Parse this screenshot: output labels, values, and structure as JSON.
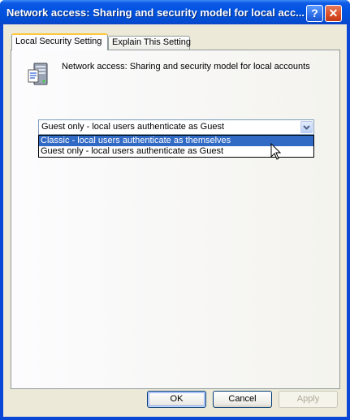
{
  "window": {
    "title": "Network access: Sharing and security model for local acc..."
  },
  "titlebar_buttons": {
    "help": "?",
    "close": "✕"
  },
  "tabs": [
    {
      "label": "Local Security Setting",
      "active": true
    },
    {
      "label": "Explain This Setting",
      "active": false
    }
  ],
  "policy": {
    "icon": "policy-server-icon",
    "name": "Network access: Sharing and security model for local accounts"
  },
  "combo": {
    "value": "Guest only - local users authenticate as Guest",
    "options": [
      {
        "label": "Classic - local users authenticate as themselves",
        "highlighted": true
      },
      {
        "label": "Guest only - local users authenticate as Guest",
        "highlighted": false
      }
    ]
  },
  "buttons": {
    "ok": "OK",
    "cancel": "Cancel",
    "apply": "Apply"
  },
  "colors": {
    "title_bar": "#0053e1",
    "selection": "#316ac5",
    "dialog_bg": "#ece9d8",
    "tab_highlight": "#ffc83c"
  }
}
